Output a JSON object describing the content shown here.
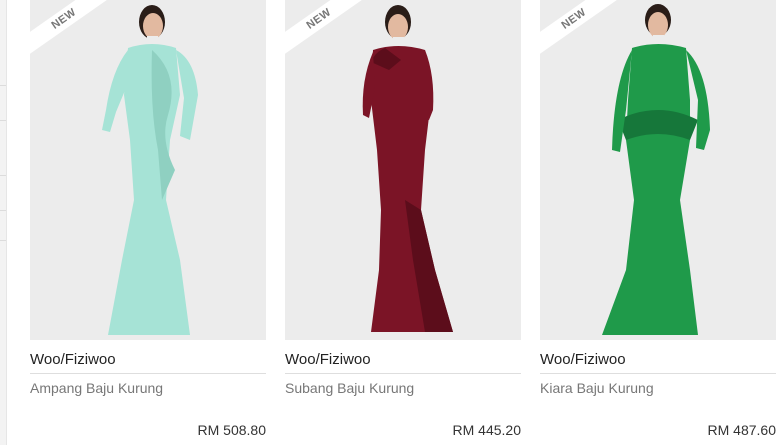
{
  "products": [
    {
      "badge": "NEW",
      "brand": "Woo/Fiziwoo",
      "name": "Ampang Baju Kurung",
      "price": "RM 508.80",
      "dress_color": "#a6e3d6",
      "dress_shade": "#8fd0c1"
    },
    {
      "badge": "NEW",
      "brand": "Woo/Fiziwoo",
      "name": "Subang Baju Kurung",
      "price": "RM 445.20",
      "dress_color": "#7b1426",
      "dress_shade": "#5c0d1b"
    },
    {
      "badge": "NEW",
      "brand": "Woo/Fiziwoo",
      "name": "Kiara Baju Kurung",
      "price": "RM 487.60",
      "dress_color": "#1f9a4a",
      "dress_shade": "#16773a"
    }
  ],
  "page_background": "#ececec"
}
